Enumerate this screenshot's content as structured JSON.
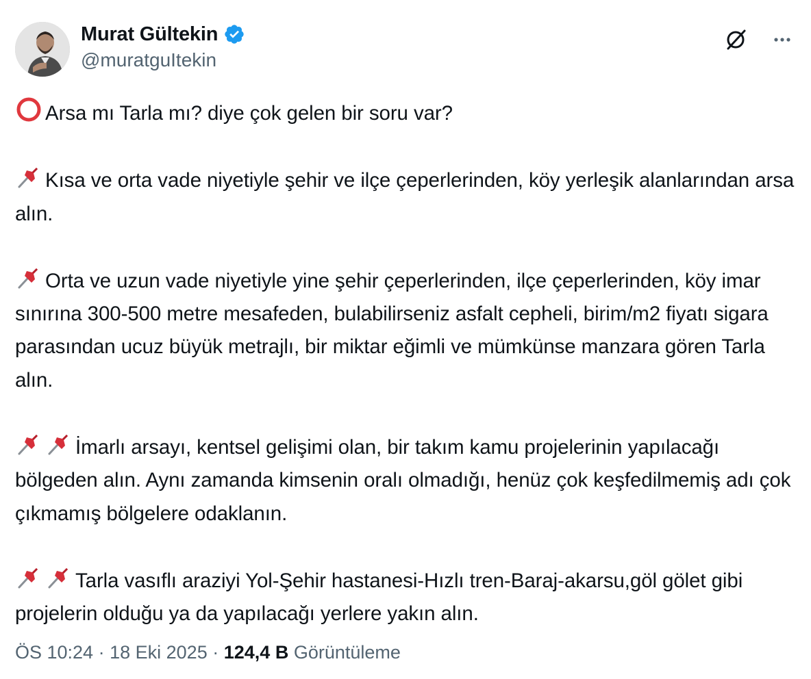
{
  "author": {
    "display_name": "Murat Gültekin",
    "handle": "@muratguItekin",
    "verified": true,
    "verified_color": "#1d9bf0"
  },
  "icons": {
    "avatar": "profile-photo",
    "verified": "verified-badge-icon",
    "grok": "grok-icon",
    "more": "more-options-icon",
    "circle": "hollow-red-circle-emoji",
    "pin": "pushpin-emoji"
  },
  "tweet": {
    "line_1": "Arsa mı Tarla mı? diye çok gelen bir soru var?",
    "para_2": "Kısa ve orta vade niyetiyle şehir ve ilçe çeperlerinden, köy yerleşik alanlarından arsa alın.",
    "para_3": "Orta ve uzun vade niyetiyle yine şehir çeperlerinden, ilçe çeperlerinden, köy imar sınırına 300-500 metre mesafeden, bulabilirseniz asfalt cepheli, birim/m2 fiyatı sigara parasından ucuz büyük metrajlı, bir miktar eğimli ve mümkünse manzara gören Tarla alın.",
    "para_4": "İmarlı arsayı, kentsel gelişimi olan, bir takım kamu projelerinin yapılacağı bölgeden alın. Aynı zamanda kimsenin oralı olmadığı, henüz çok keşfedilmemiş adı çok çıkmamış bölgelere odaklanın.",
    "para_5": "Tarla vasıflı araziyi Yol-Şehir hastanesi-Hızlı tren-Baraj-akarsu,göl gölet gibi projelerin olduğu ya da yapılacağı yerlere yakın alın."
  },
  "meta": {
    "time": "ÖS 10:24",
    "separator": "·",
    "date": "18 Eki 2025",
    "views_count": "124,4 B",
    "views_label": "Görüntüleme"
  },
  "colors": {
    "text": "#0f1419",
    "secondary": "#536471",
    "pin_red": "#d62f3a",
    "circle_red": "#e0383e"
  }
}
